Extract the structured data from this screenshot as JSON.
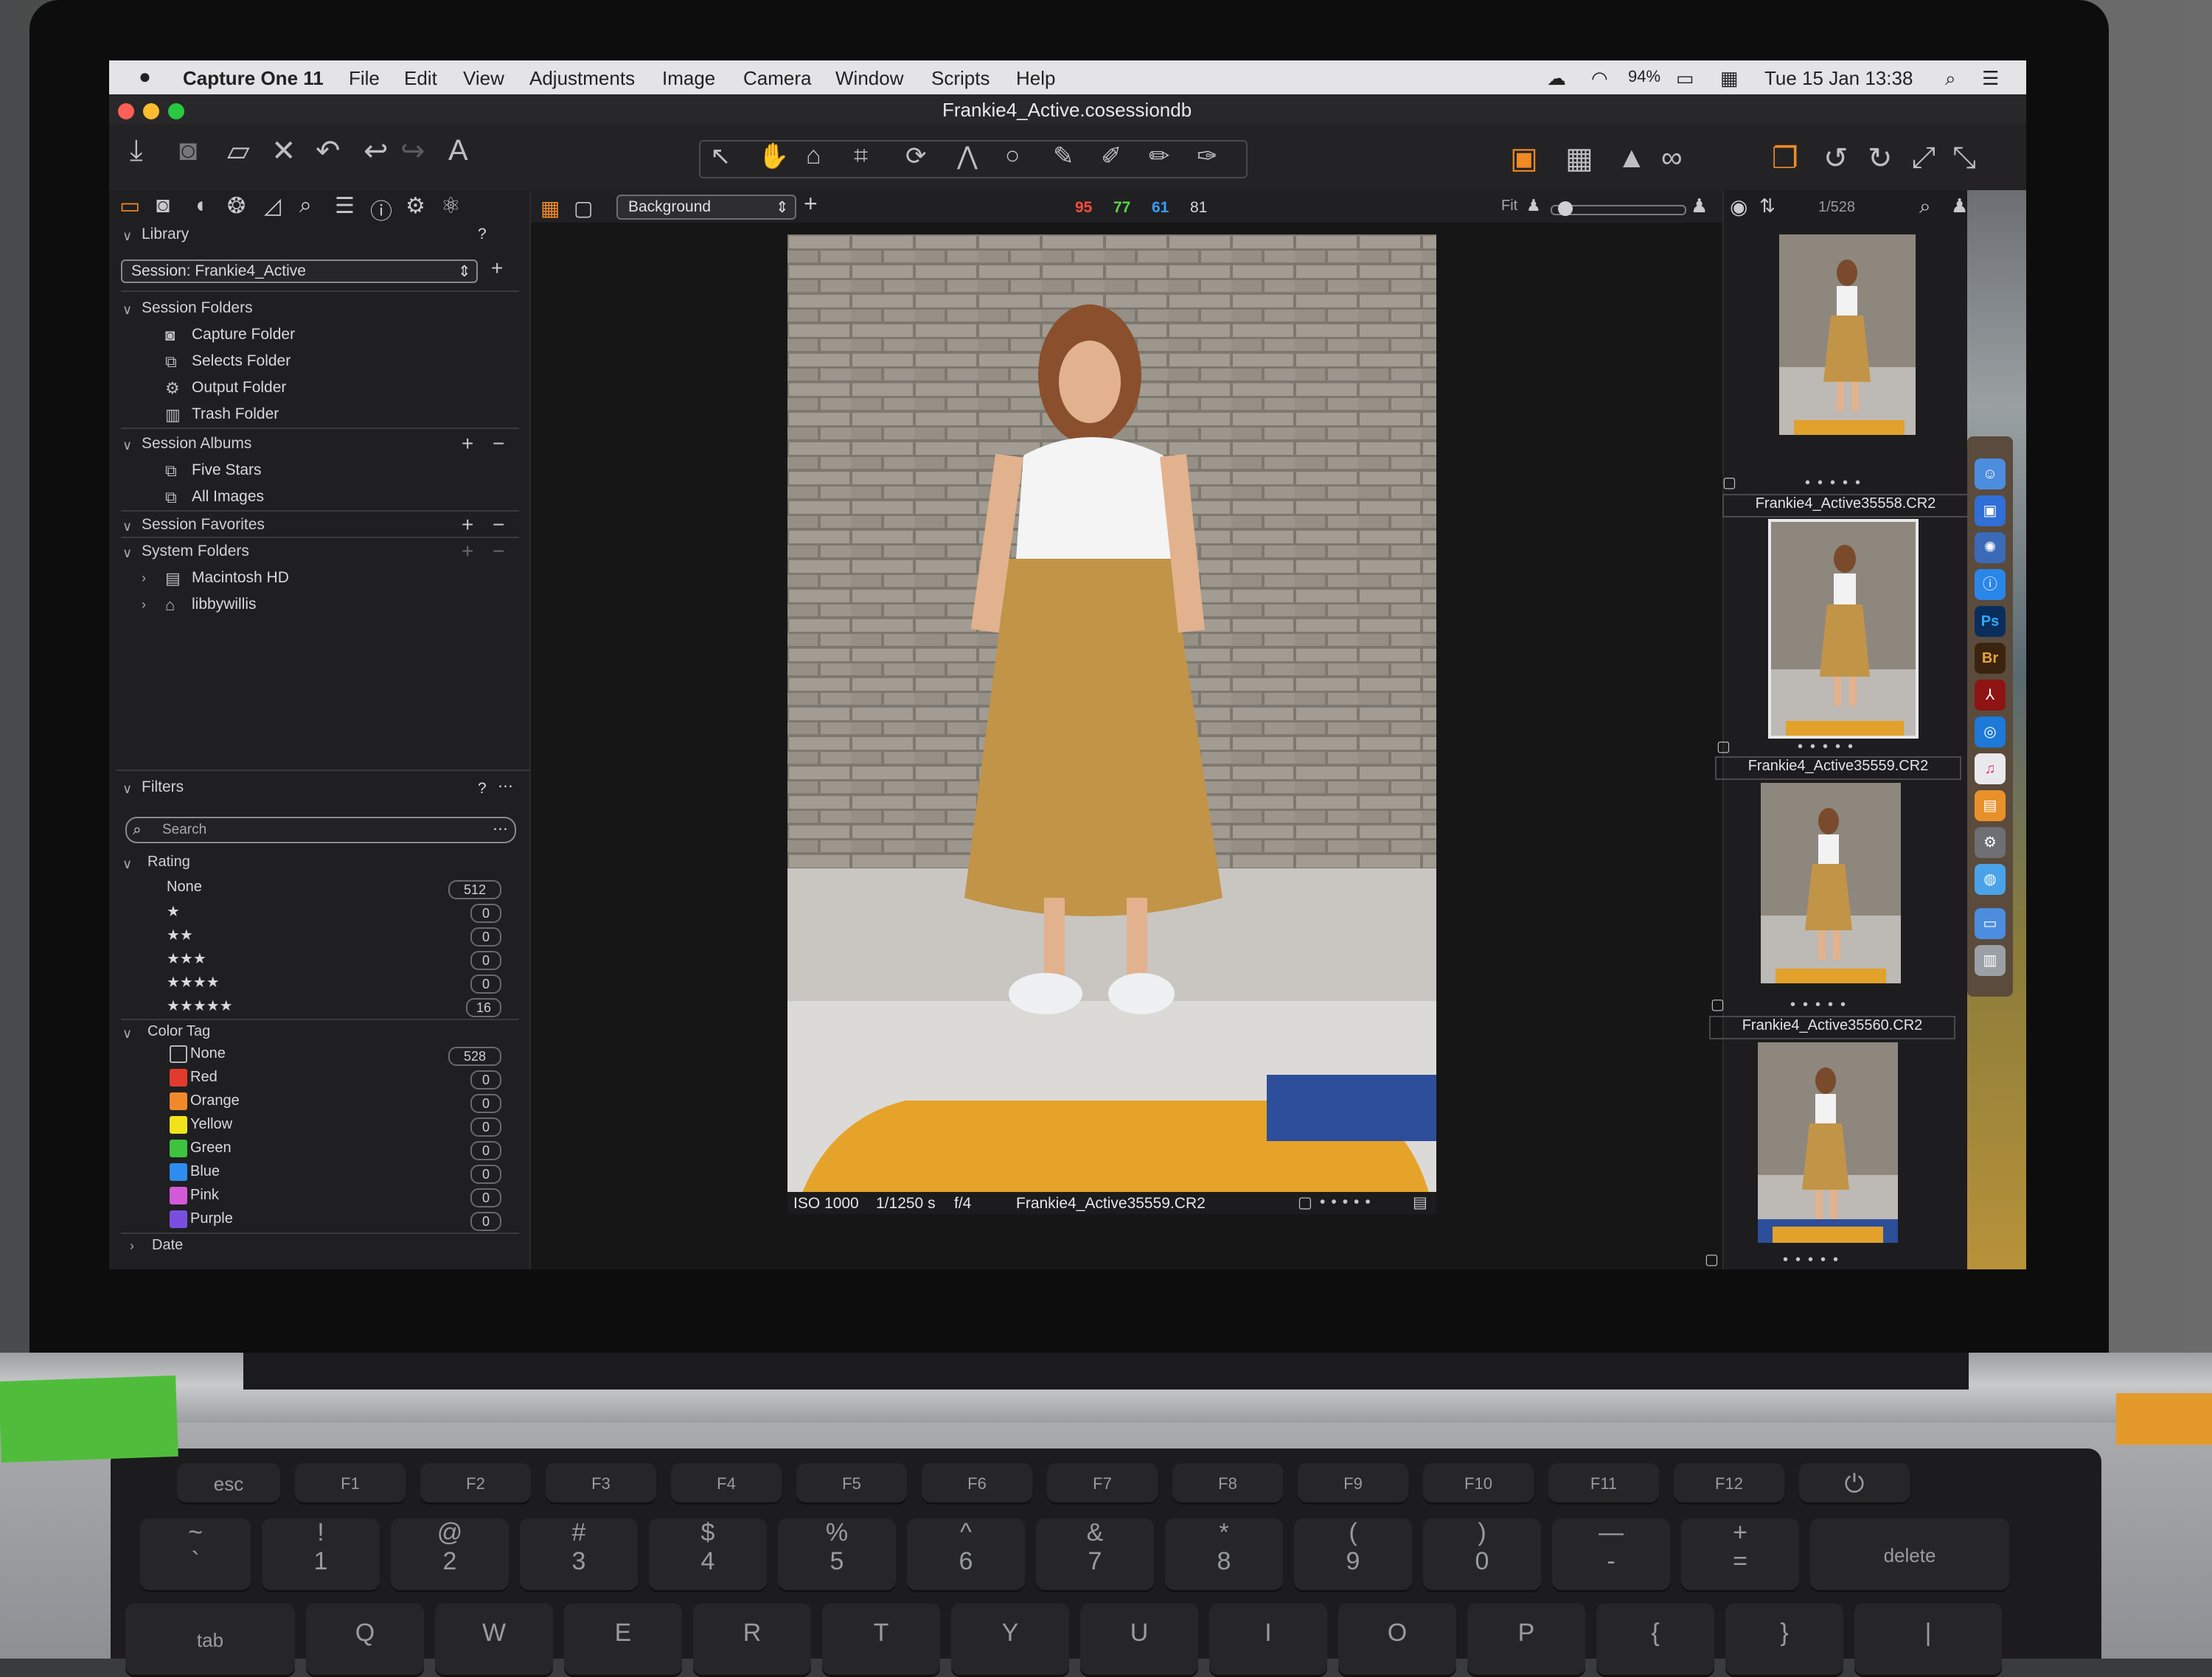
{
  "menubar": {
    "app_name": "Capture One 11",
    "menus": [
      "File",
      "Edit",
      "View",
      "Adjustments",
      "Image",
      "Camera",
      "Window",
      "Scripts",
      "Help"
    ],
    "battery": "94%",
    "clock": "Tue 15 Jan  13:38"
  },
  "window": {
    "title": "Frankie4_Active.cosessiondb"
  },
  "library": {
    "header": "Library",
    "help": "?",
    "session_select": "Session: Frankie4_Active",
    "session_folders": {
      "label": "Session Folders",
      "items": [
        "Capture Folder",
        "Selects Folder",
        "Output Folder",
        "Trash Folder"
      ]
    },
    "session_albums": {
      "label": "Session Albums",
      "items": [
        "Five Stars",
        "All Images"
      ]
    },
    "session_favorites": {
      "label": "Session Favorites"
    },
    "system_folders": {
      "label": "System Folders",
      "items": [
        "Macintosh HD",
        "libbywillis"
      ]
    }
  },
  "filters": {
    "header": "Filters",
    "help": "?",
    "search_placeholder": "Search",
    "rating": {
      "label": "Rating",
      "rows": [
        {
          "label": "None",
          "count": "512"
        },
        {
          "label": "★",
          "count": "0"
        },
        {
          "label": "★★",
          "count": "0"
        },
        {
          "label": "★★★",
          "count": "0"
        },
        {
          "label": "★★★★",
          "count": "0"
        },
        {
          "label": "★★★★★",
          "count": "16"
        }
      ]
    },
    "color_tag": {
      "label": "Color Tag",
      "rows": [
        {
          "label": "None",
          "count": "528",
          "color": "#1f1f21"
        },
        {
          "label": "Red",
          "count": "0",
          "color": "#e23b2e"
        },
        {
          "label": "Orange",
          "count": "0",
          "color": "#f0892a"
        },
        {
          "label": "Yellow",
          "count": "0",
          "color": "#f2e21c"
        },
        {
          "label": "Green",
          "count": "0",
          "color": "#3ec43e"
        },
        {
          "label": "Blue",
          "count": "0",
          "color": "#2d8cf0"
        },
        {
          "label": "Pink",
          "count": "0",
          "color": "#d35ad8"
        },
        {
          "label": "Purple",
          "count": "0",
          "color": "#7a4fe0"
        }
      ]
    },
    "date": {
      "label": "Date"
    }
  },
  "viewer": {
    "style_select": "Background",
    "exposure": {
      "r": "95",
      "g": "77",
      "b": "61",
      "l": "81"
    },
    "fit_label": "Fit",
    "image_counter": "1/528",
    "info": {
      "iso": "ISO 1000",
      "shutter": "1/1250 s",
      "aperture": "f/4",
      "filename": "Frankie4_Active35559.CR2"
    }
  },
  "filmstrip": {
    "thumbnails": [
      {
        "caption": "Frankie4_Active35558.CR2",
        "selected": false
      },
      {
        "caption": "Frankie4_Active35559.CR2",
        "selected": true
      },
      {
        "caption": "Frankie4_Active35560.CR2",
        "selected": false
      },
      {
        "caption": "",
        "selected": false
      }
    ]
  },
  "dock": {
    "apps": [
      "Ps",
      "Br"
    ]
  },
  "keyboard": {
    "fn_row": [
      "esc",
      "F1",
      "F2",
      "F3",
      "F4",
      "F5",
      "F6",
      "F7",
      "F8",
      "F9",
      "F10",
      "F11",
      "F12"
    ],
    "num_row": [
      {
        "top": "~",
        "bottom": "`"
      },
      {
        "top": "!",
        "bottom": "1"
      },
      {
        "top": "@",
        "bottom": "2"
      },
      {
        "top": "#",
        "bottom": "3"
      },
      {
        "top": "$",
        "bottom": "4"
      },
      {
        "top": "%",
        "bottom": "5"
      },
      {
        "top": "^",
        "bottom": "6"
      },
      {
        "top": "&",
        "bottom": "7"
      },
      {
        "top": "*",
        "bottom": "8"
      },
      {
        "top": "(",
        "bottom": "9"
      },
      {
        "top": ")",
        "bottom": "0"
      },
      {
        "top": "—",
        "bottom": "-"
      },
      {
        "top": "+",
        "bottom": "="
      }
    ],
    "delete": "delete",
    "tab": "tab",
    "letters": [
      "Q",
      "W",
      "E",
      "R",
      "T",
      "Y",
      "U",
      "I",
      "O",
      "P",
      "{",
      "}",
      "|"
    ]
  }
}
